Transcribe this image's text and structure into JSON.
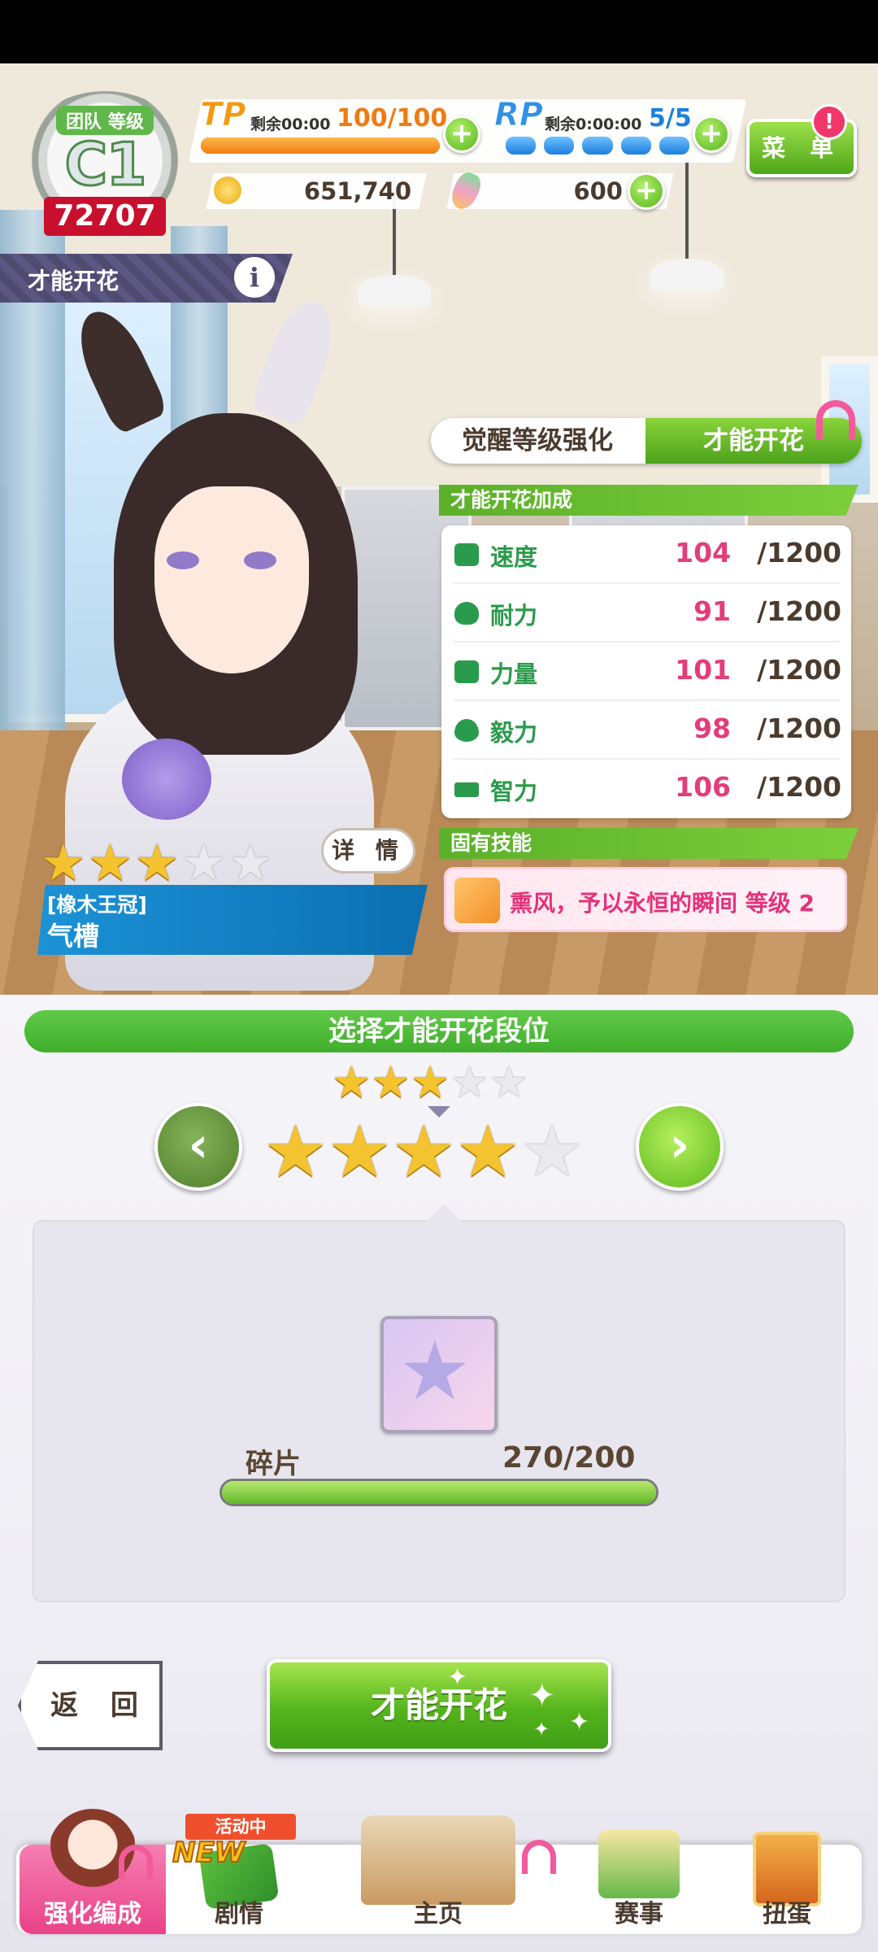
{
  "header": {
    "rank_label": "团队 等级",
    "rank_grade": "C1",
    "team_score": "72707",
    "tp": {
      "label": "TP",
      "remain": "剩余00:00",
      "value": "100/100",
      "fill": 1.0
    },
    "rp": {
      "label": "RP",
      "remain": "剩余0:00:00",
      "value": "5/5",
      "pips": 5
    },
    "coins": "651,740",
    "carrots": "600",
    "menu_label": "菜 单",
    "menu_alert": "!"
  },
  "page": {
    "title": "才能开花",
    "info": "i"
  },
  "tabs": {
    "awaken": "觉醒等级强化",
    "bloom": "才能开花"
  },
  "bonus": {
    "section_title": "才能开花加成",
    "stats": [
      {
        "name": "速度",
        "value": "104",
        "max": "/1200",
        "icon": "shoe-icon"
      },
      {
        "name": "耐力",
        "value": "91",
        "max": "/1200",
        "icon": "heart-icon"
      },
      {
        "name": "力量",
        "value": "101",
        "max": "/1200",
        "icon": "muscle-icon"
      },
      {
        "name": "毅力",
        "value": "98",
        "max": "/1200",
        "icon": "flame-icon"
      },
      {
        "name": "智力",
        "value": "106",
        "max": "/1200",
        "icon": "graduation-cap-icon"
      }
    ]
  },
  "skill": {
    "section_title": "固有技能",
    "name": "熏风，予以永恒的瞬间 等级 2"
  },
  "character": {
    "rarity_current": 3,
    "rarity_max": 5,
    "detail_label": "详 情",
    "epithet": "[橡木王冠]",
    "name": "气槽"
  },
  "selector": {
    "title": "选择才能开花段位",
    "current_stars": 3,
    "target_stars": 4,
    "total_stars": 5,
    "prev": "‹",
    "next": "›"
  },
  "shards": {
    "label": "碎片",
    "count": "270/200",
    "fill": 1.0
  },
  "actions": {
    "back": "返 回",
    "bloom": "才能开花"
  },
  "nav": {
    "items": [
      {
        "label": "强化编成",
        "active": true
      },
      {
        "label": "剧情",
        "badge": "活动中",
        "new": "NEW"
      },
      {
        "label": "主页"
      },
      {
        "label": "赛事"
      },
      {
        "label": "扭蛋"
      }
    ]
  },
  "colors": {
    "accent_green": "#4ca21b",
    "stat_green": "#2a9b4c",
    "stat_value_pink": "#e33d7a",
    "nameplate_blue": "#1c92d6",
    "nav_active_pink": "#e94289"
  }
}
